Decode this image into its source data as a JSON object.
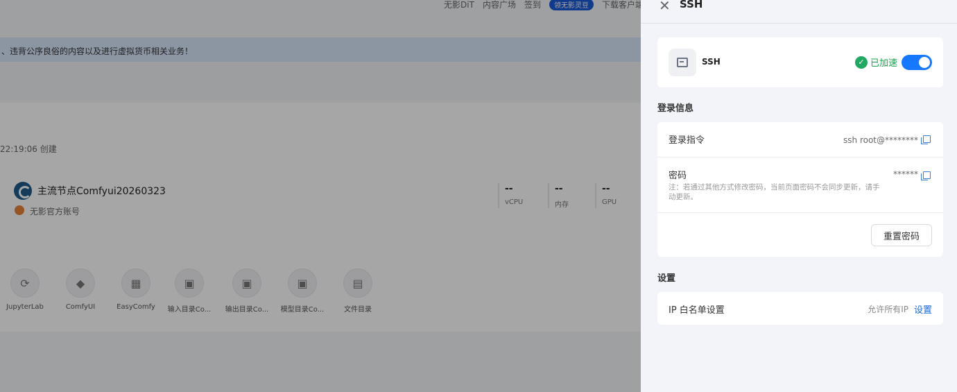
{
  "background": {
    "nav_links": [
      "无影DiT",
      "内容广场",
      "签到"
    ],
    "nav_badge": "领无影灵豆",
    "nav_download": "下载客户端",
    "notice": "、违背公序良俗的内容以及进行虚拟货币相关业务！",
    "created": "22:19:06 创建",
    "node_name": "主流节点Comfyui20260323",
    "account": "无影官方账号",
    "metrics": [
      {
        "value": "--",
        "label": "vCPU"
      },
      {
        "value": "--",
        "label": "内存"
      },
      {
        "value": "--",
        "label": "GPU"
      }
    ],
    "apps": [
      {
        "name": "JupyterLab",
        "icon": "jupyter-icon"
      },
      {
        "name": "ComfyUI",
        "icon": "comfy-icon"
      },
      {
        "name": "EasyComfy",
        "icon": "layout-icon"
      },
      {
        "name": "输入目录Co...",
        "icon": "folder-icon"
      },
      {
        "name": "输出目录Co...",
        "icon": "folder-icon"
      },
      {
        "name": "模型目录Co...",
        "icon": "folder-icon"
      },
      {
        "name": "文件目录",
        "icon": "file-icon"
      }
    ]
  },
  "drawer": {
    "title": "SSH",
    "ssh_card": {
      "label": "SSH",
      "status": "已加速",
      "enabled": true,
      "status_color": "#16a34a",
      "toggle_color": "#1677ff"
    },
    "login_section": "登录信息",
    "login_command": {
      "label": "登录指令",
      "value": "ssh root@********"
    },
    "password": {
      "label": "密码",
      "value": "******",
      "note": "注：若通过其他方式修改密码，当前页面密码不会同步更新，请手动更新。"
    },
    "reset_button": "重置密码",
    "settings_section": "设置",
    "ip_whitelist": {
      "label": "IP 白名单设置",
      "value": "允许所有IP",
      "action": "设置"
    }
  }
}
